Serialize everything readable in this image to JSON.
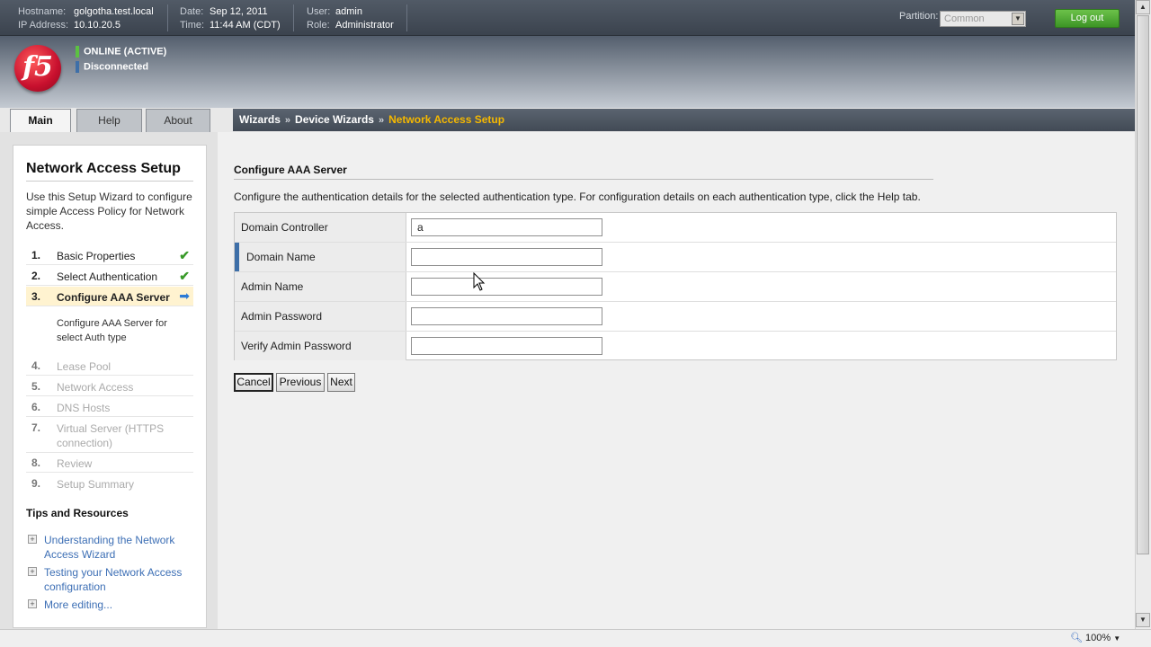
{
  "header": {
    "hostname_label": "Hostname:",
    "hostname": "golgotha.test.local",
    "ip_label": "IP Address:",
    "ip": "10.10.20.5",
    "date_label": "Date:",
    "date": "Sep 12, 2011",
    "time_label": "Time:",
    "time": "11:44 AM (CDT)",
    "user_label": "User:",
    "user": "admin",
    "role_label": "Role:",
    "role": "Administrator",
    "partition_label": "Partition:",
    "partition_value": "Common",
    "logout_label": "Log out",
    "logo_text": "f5",
    "status_online": "ONLINE (ACTIVE)",
    "status_online_color": "#5cc142",
    "status_disconnected": "Disconnected",
    "status_disconnected_color": "#3e6fa8"
  },
  "tabs": [
    {
      "label": "Main",
      "active": true
    },
    {
      "label": "Help",
      "active": false
    },
    {
      "label": "About",
      "active": false
    }
  ],
  "breadcrumb": {
    "items": [
      "Wizards",
      "Device Wizards",
      "Network Access Setup"
    ],
    "separator": "»"
  },
  "sidebar": {
    "title": "Network Access Setup",
    "description": "Use this Setup Wizard to configure simple Access Policy for Network Access.",
    "steps": [
      {
        "num": "1.",
        "label": "Basic Properties",
        "state": "done"
      },
      {
        "num": "2.",
        "label": "Select Authentication",
        "state": "done"
      },
      {
        "num": "3.",
        "label": "Configure AAA Server",
        "state": "current"
      },
      {
        "num": "4.",
        "label": "Lease Pool",
        "state": "disabled"
      },
      {
        "num": "5.",
        "label": "Network Access",
        "state": "disabled"
      },
      {
        "num": "6.",
        "label": "DNS Hosts",
        "state": "disabled"
      },
      {
        "num": "7.",
        "label": "Virtual Server (HTTPS connection)",
        "state": "disabled"
      },
      {
        "num": "8.",
        "label": "Review",
        "state": "disabled"
      },
      {
        "num": "9.",
        "label": "Setup Summary",
        "state": "disabled"
      }
    ],
    "current_step_detail": "Configure AAA Server for select Auth type",
    "tips_title": "Tips and Resources",
    "tips": [
      "Understanding the Network Access Wizard",
      "Testing your Network Access configuration",
      "More editing..."
    ]
  },
  "main": {
    "section_title": "Configure AAA Server",
    "section_description": "Configure the authentication details for the selected authentication type. For configuration details on each authentication type, click the Help tab.",
    "fields": [
      {
        "label": "Domain Controller",
        "value": "a",
        "required": false
      },
      {
        "label": "Domain Name",
        "value": "",
        "required": true
      },
      {
        "label": "Admin Name",
        "value": "",
        "required": false
      },
      {
        "label": "Admin Password",
        "value": "",
        "required": false
      },
      {
        "label": "Verify Admin Password",
        "value": "",
        "required": false
      }
    ],
    "buttons": {
      "cancel": "Cancel",
      "previous": "Previous",
      "next": "Next"
    }
  },
  "statusbar": {
    "zoom": "100%"
  }
}
